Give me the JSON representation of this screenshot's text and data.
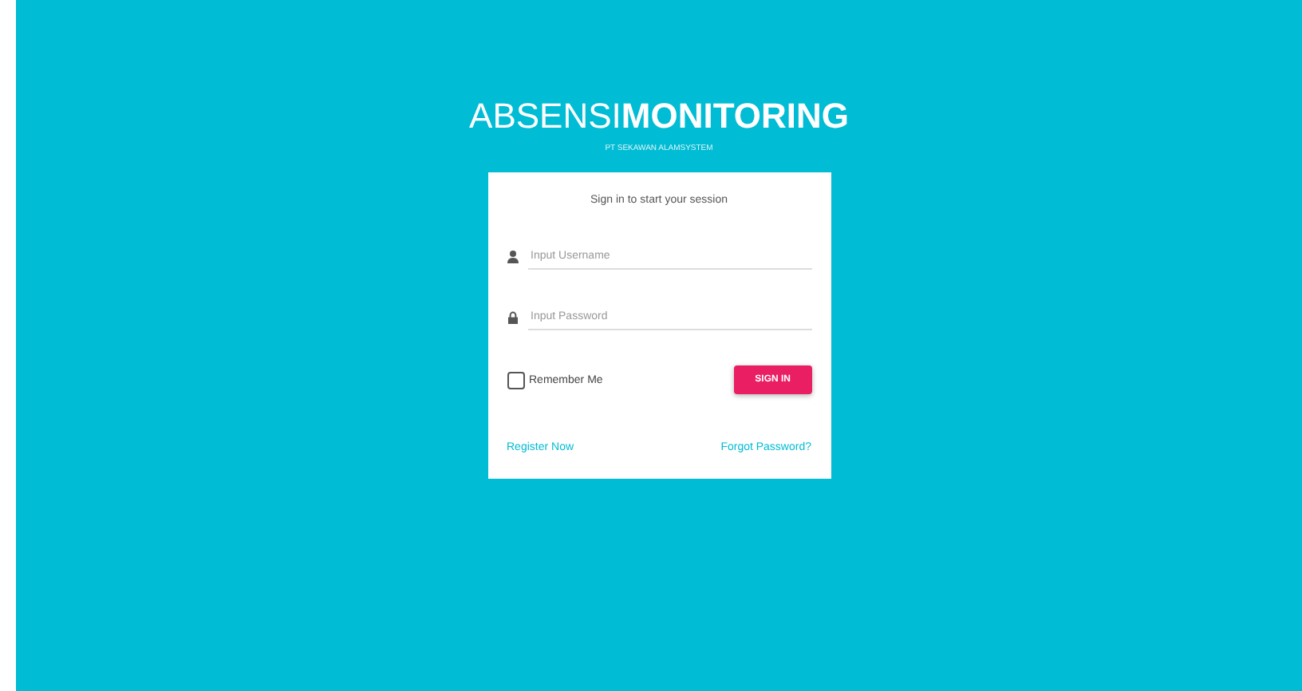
{
  "logo": {
    "light": "ABSENSI",
    "bold": "MONITORING",
    "subtitle": "PT SEKAWAN ALAMSYSTEM"
  },
  "card": {
    "message": "Sign in to start your session",
    "fields": [
      {
        "kind": "user",
        "placeholder": "Input Username"
      },
      {
        "kind": "lock",
        "placeholder": "Input Password"
      }
    ],
    "remember": {
      "label": "Remember Me",
      "checked": false
    },
    "submit": "SIGN IN",
    "links": [
      "Register Now",
      "Forgot Password?"
    ]
  }
}
